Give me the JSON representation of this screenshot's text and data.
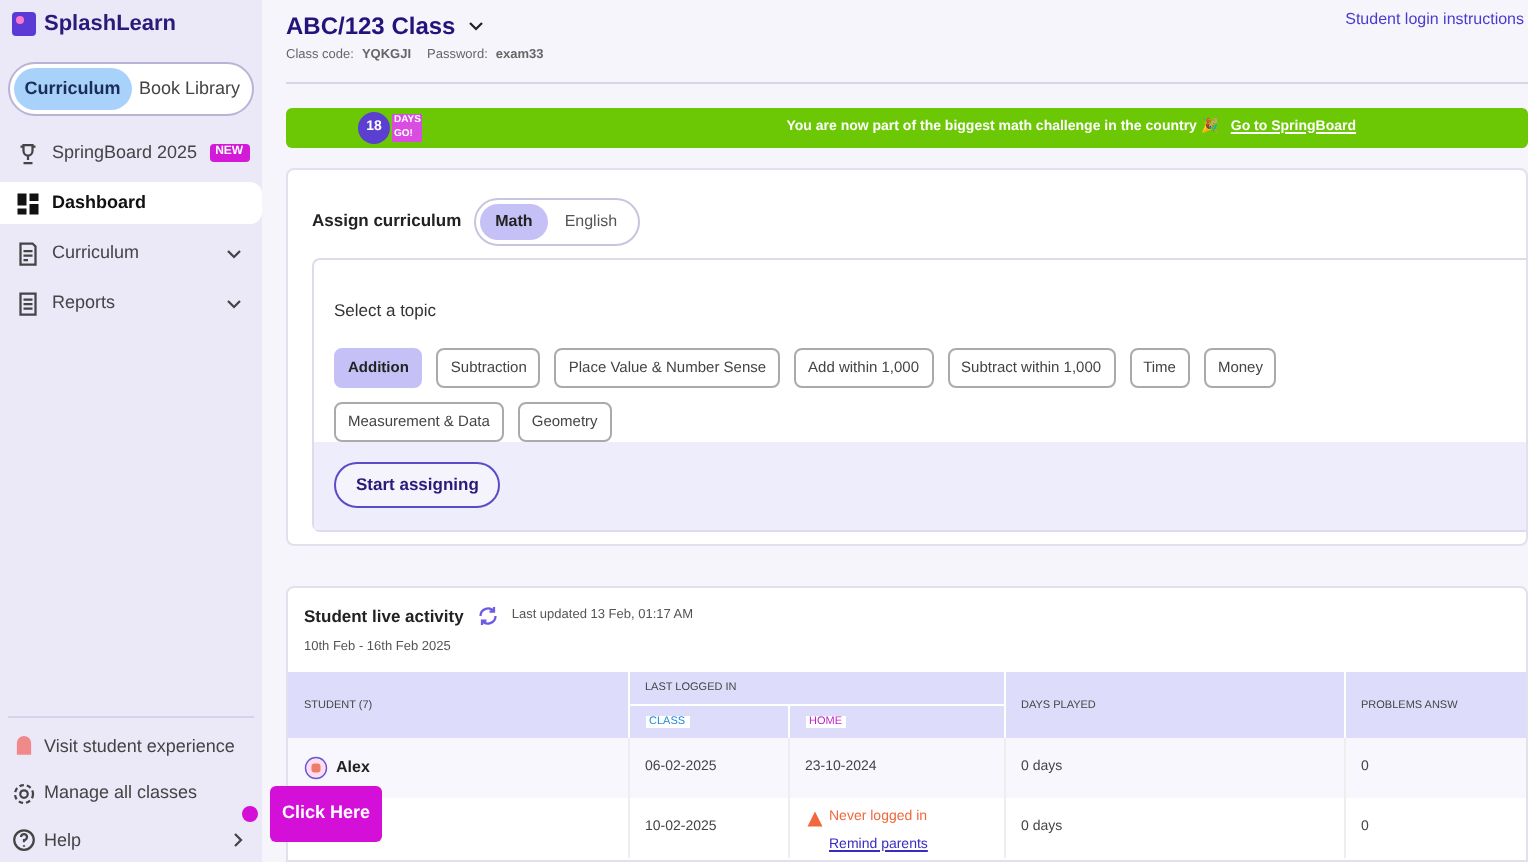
{
  "sidebar": {
    "logo": "SplashLearn",
    "switch": [
      {
        "label": "Curriculum",
        "selected": true
      },
      {
        "label": "Book Library",
        "selected": false
      }
    ],
    "items": [
      {
        "label": "SpringBoard 2025",
        "badge": "NEW",
        "selected": false,
        "kind": "trophy",
        "expandable": false
      },
      {
        "label": "Dashboard",
        "selected": true,
        "kind": "dashboard",
        "expandable": false
      },
      {
        "label": "Curriculum",
        "selected": false,
        "kind": "curriculum",
        "expandable": true
      },
      {
        "label": "Reports",
        "selected": false,
        "kind": "reports",
        "expandable": true
      }
    ],
    "footer": [
      {
        "label": "Visit student experience",
        "kind": "student"
      },
      {
        "label": "Manage all classes",
        "kind": "gear"
      },
      {
        "label": "Help",
        "kind": "help"
      }
    ]
  },
  "header": {
    "title": "ABC/123 Class",
    "class_code_label": "Class code:",
    "class_code": "YQKGJI",
    "password_label": "Password:",
    "password": "exam33",
    "link": "Student login instructions"
  },
  "banner": {
    "days": "18",
    "days_word": "DAYS",
    "go": "GO!",
    "message": "You are now part of the biggest math challenge in the country 🎉",
    "link": "Go to SpringBoard"
  },
  "assign": {
    "title": "Assign curriculum",
    "subjects": [
      {
        "label": "Math",
        "selected": true
      },
      {
        "label": "English",
        "selected": false
      }
    ],
    "topic_title": "Select a topic",
    "topics": [
      {
        "label": "Addition",
        "selected": true
      },
      {
        "label": "Subtraction",
        "selected": false
      },
      {
        "label": "Place Value & Number Sense",
        "selected": false
      },
      {
        "label": "Add within 1,000",
        "selected": false
      },
      {
        "label": "Subtract within 1,000",
        "selected": false
      },
      {
        "label": "Time",
        "selected": false
      },
      {
        "label": "Money",
        "selected": false
      },
      {
        "label": "Measurement & Data",
        "selected": false
      },
      {
        "label": "Geometry",
        "selected": false
      }
    ],
    "button": "Start assigning"
  },
  "activity": {
    "title": "Student live activity",
    "updated": "Last updated 13 Feb, 01:17 AM",
    "range": "10th Feb - 16th Feb 2025",
    "columns": {
      "student": "STUDENT (7)",
      "last_logged": "LAST LOGGED IN",
      "class": "CLASS",
      "home": "HOME",
      "days": "DAYS PLAYED",
      "problems": "PROBLEMS ANSW"
    },
    "rows": [
      {
        "name": "Alex",
        "class": "06-02-2025",
        "home": "23-10-2024",
        "never": false,
        "days": "0 days",
        "problems": "0"
      },
      {
        "class": "10-02-2025",
        "home": "Never logged in",
        "remind": "Remind parents",
        "never": true,
        "days": "0 days",
        "problems": "0"
      }
    ]
  },
  "callout": "Click Here"
}
